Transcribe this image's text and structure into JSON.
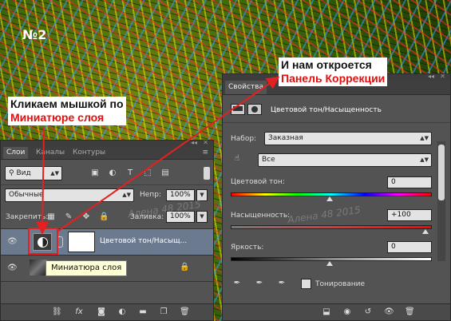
{
  "title_number": "№2",
  "callouts": {
    "left_line1": "Кликаем мышкой по",
    "left_line2": "Миниатюре слоя",
    "right_line1": "И нам откроется",
    "right_line2": "Панель Коррекции"
  },
  "watermarks": [
    "Алена 48 2015",
    "Алена 48 2015"
  ],
  "layers_panel": {
    "tabs": [
      "Слои",
      "Каналы",
      "Контуры"
    ],
    "filter": "Вид",
    "blend_mode": "Обычные",
    "opacity_label": "Непр:",
    "opacity_value": "100%",
    "lock_label": "Закрепить:",
    "fill_label": "Заливка:",
    "fill_value": "100%",
    "layers": [
      {
        "name": "Цветовой тон/Насыщ..."
      },
      {
        "name": ""
      }
    ],
    "tooltip": "Миниатюра слоя"
  },
  "properties_panel": {
    "tab": "Свойства",
    "adjustment_title": "Цветовой тон/Насыщенность",
    "preset_label": "Набор:",
    "preset_value": "Заказная",
    "channel_value": "Все",
    "hue_label": "Цветовой тон:",
    "hue_value": "0",
    "sat_label": "Насыщенность:",
    "sat_value": "+100",
    "light_label": "Яркость:",
    "light_value": "0",
    "colorize_label": "Тонирование"
  },
  "colors": {
    "panel": "#535353",
    "callout_red": "#e01010",
    "arrow_red": "#e52020",
    "selected_layer": "#6c7a90"
  }
}
